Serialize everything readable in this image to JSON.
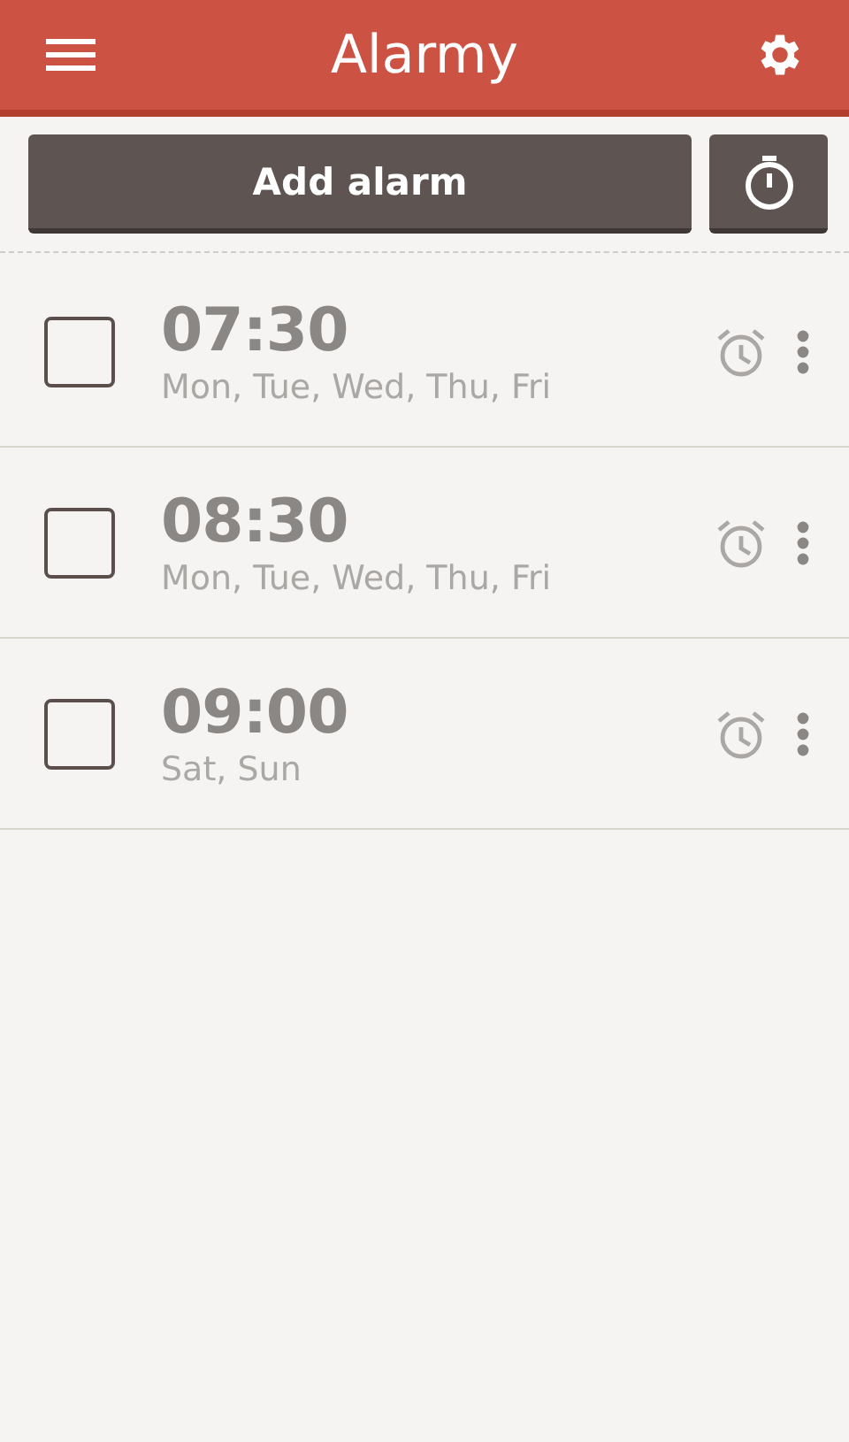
{
  "app_bar": {
    "title": "Alarmy"
  },
  "actions": {
    "add_button": "Add alarm"
  },
  "alarms": [
    {
      "time": "07:30",
      "days": "Mon, Tue, Wed, Thu, Fri",
      "checked": false
    },
    {
      "time": "08:30",
      "days": "Mon, Tue, Wed, Thu, Fri",
      "checked": false
    },
    {
      "time": "09:00",
      "days": "Sat, Sun",
      "checked": false
    }
  ]
}
